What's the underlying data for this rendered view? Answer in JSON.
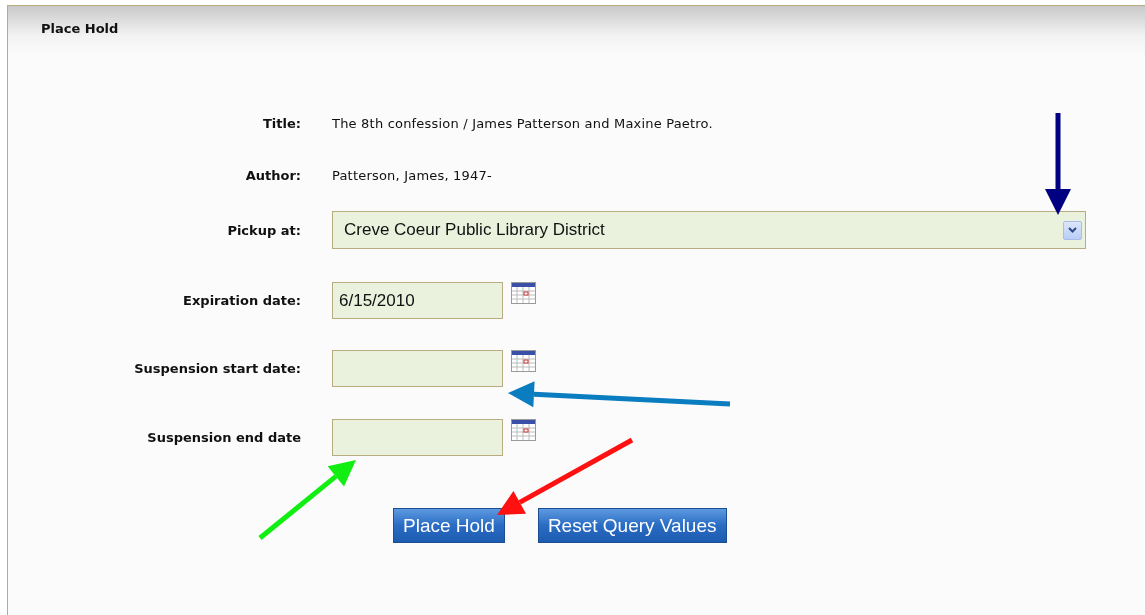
{
  "panel": {
    "title": "Place Hold"
  },
  "fields": [
    {
      "kind": "text",
      "label": "Title:",
      "value": "The 8th confession / James Patterson and Maxine Paetro."
    },
    {
      "kind": "text",
      "label": "Author:",
      "value": "Patterson, James, 1947-"
    },
    {
      "kind": "select",
      "label": "Pickup at:",
      "value": "Creve Coeur Public Library District"
    },
    {
      "kind": "date",
      "label": "Expiration date:",
      "value": "6/15/2010"
    },
    {
      "kind": "date",
      "label": "Suspension start date:"
    },
    {
      "kind": "date",
      "label": "Suspension end date"
    }
  ],
  "buttons": [
    "Place Hold",
    "Reset Query Values"
  ],
  "annotations": [
    {
      "kind": "arrow",
      "color": "#000080"
    },
    {
      "kind": "arrow",
      "color": "#0a7cc0"
    },
    {
      "kind": "arrow",
      "color": "#11ee11"
    },
    {
      "kind": "arrow",
      "color": "#ff1111"
    }
  ]
}
